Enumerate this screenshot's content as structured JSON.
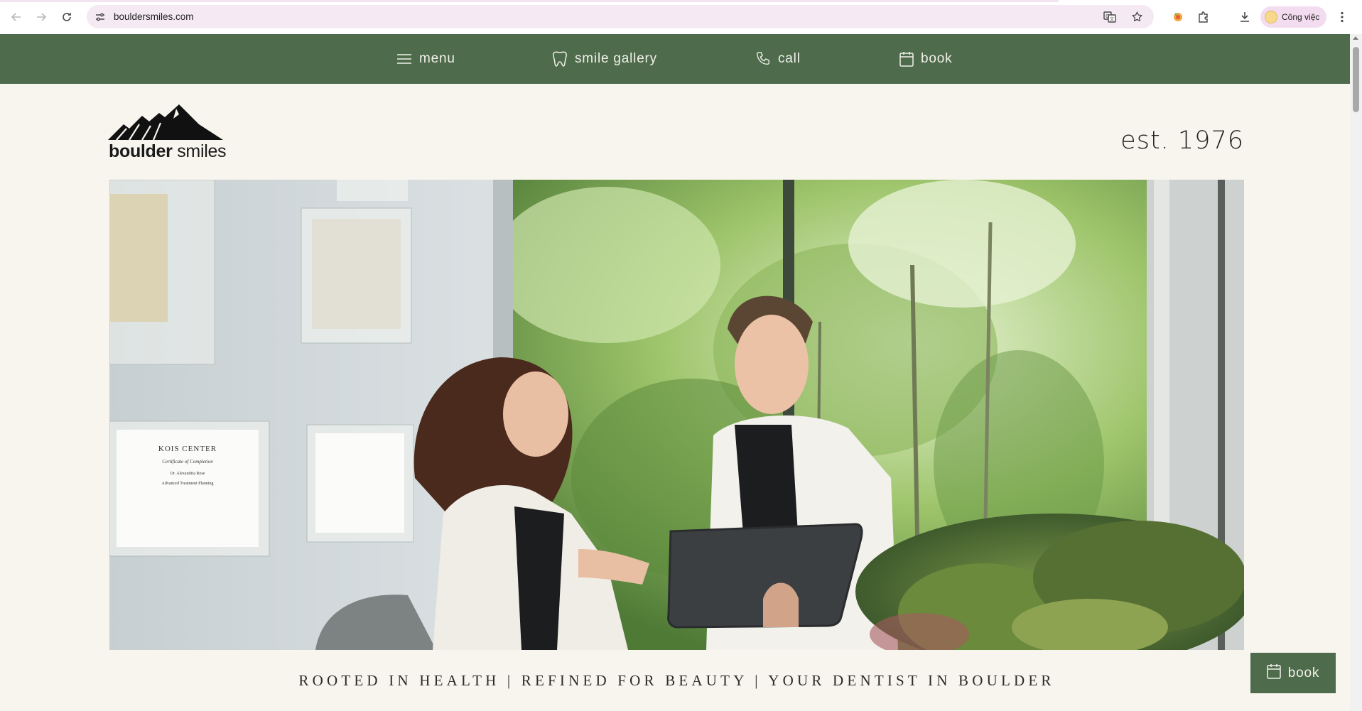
{
  "browser": {
    "url": "bouldersmiles.com",
    "profile_label": "Công việc",
    "icons": {
      "back": "back-arrow-icon",
      "forward": "forward-arrow-icon",
      "reload": "reload-icon",
      "site_info": "tune-icon",
      "translate": "translate-icon",
      "bookmark": "star-icon",
      "extension_1": "extension-color-icon",
      "extensions": "puzzle-icon",
      "downloads": "download-icon",
      "menu": "kebab-menu-icon"
    }
  },
  "site_nav": {
    "items": [
      {
        "label": "menu",
        "icon": "hamburger-icon"
      },
      {
        "label": "smile gallery",
        "icon": "tooth-icon"
      },
      {
        "label": "call",
        "icon": "phone-icon"
      },
      {
        "label": "book",
        "icon": "calendar-icon"
      }
    ]
  },
  "header": {
    "logo_text_bold": "boulder",
    "logo_text_light": " smiles",
    "established": "est. 1976"
  },
  "hero": {
    "kois_certificate_title": "KOIS CENTER",
    "kois_certificate_subtitle": "Certificate of Completion",
    "kois_certificate_name": "Dr. Alexandria Rose",
    "kois_certificate_course": "Advanced Treatment Planning"
  },
  "tagline": "ROOTED IN HEALTH | REFINED FOR BEAUTY | YOUR DENTIST IN BOULDER",
  "floating_button": {
    "label": "book",
    "icon": "calendar-icon"
  },
  "colors": {
    "brand_green": "#4e6b4c",
    "page_background": "#f7f5ee",
    "omnibox": "#f5e9f4"
  }
}
